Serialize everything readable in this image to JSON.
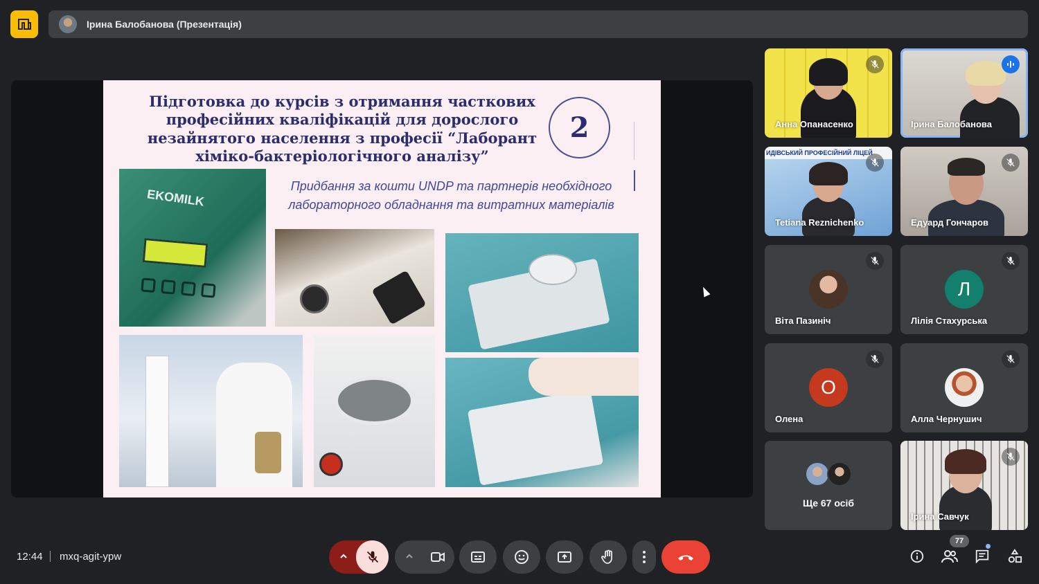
{
  "presenter": {
    "name": "Ірина Балобанова (Презентація)"
  },
  "slide": {
    "title": "Підготовка до курсів з отримання часткових\nпрофесійних кваліфікацій для дорослого\nнезайнятого населення з професії “Лаборант\nхіміко-бактеріологічного аналізу”",
    "number": "2",
    "subtitle": "Придбання за кошти UNDP та партнерів необхідного лабораторного обладнання та витратних матеріалів",
    "photo_label": "EKOMILK"
  },
  "participants": [
    {
      "name": "Анна Опанасенко",
      "type": "video",
      "muted": true
    },
    {
      "name": "Ірина Балобанова",
      "type": "video",
      "speaking": true
    },
    {
      "name": "Tetiana Reznichenko",
      "type": "video",
      "muted": true,
      "overlay_text": "ИДІВСЬКИЙ ПРОФЕСІЙНИЙ ЛІЦЕЙ"
    },
    {
      "name": "Едуард Гончаров",
      "type": "video",
      "muted": true
    },
    {
      "name": "Віта Пазиніч",
      "type": "avatar-photo",
      "muted": true
    },
    {
      "name": "Лілія Стахурська",
      "type": "avatar-letter",
      "letter": "Л",
      "color": "#12806d",
      "muted": true
    },
    {
      "name": "Олена",
      "type": "avatar-letter",
      "letter": "О",
      "color": "#c5391f",
      "muted": true
    },
    {
      "name": "Алла Чернушич",
      "type": "avatar-photo",
      "muted": true
    },
    {
      "name": "Ще 67 осіб",
      "type": "more"
    },
    {
      "name": "Ірина Савчук",
      "type": "video",
      "muted": true
    }
  ],
  "bottom": {
    "time": "12:44",
    "meeting_code": "mxq-agit-ypw",
    "participant_count": "77"
  },
  "icons": [
    "meet-logo-icon",
    "mic-off-icon",
    "chevron-up-icon",
    "camera-icon",
    "captions-icon",
    "emoji-icon",
    "present-icon",
    "hand-icon",
    "more-vert-icon",
    "hangup-icon",
    "info-icon",
    "people-icon",
    "chat-icon",
    "activities-icon"
  ],
  "colors": {
    "accent": "#8ab4f8",
    "hangup": "#ea4335",
    "mic_off_bg": "#f9dedc",
    "logo": "#fbbc04"
  }
}
